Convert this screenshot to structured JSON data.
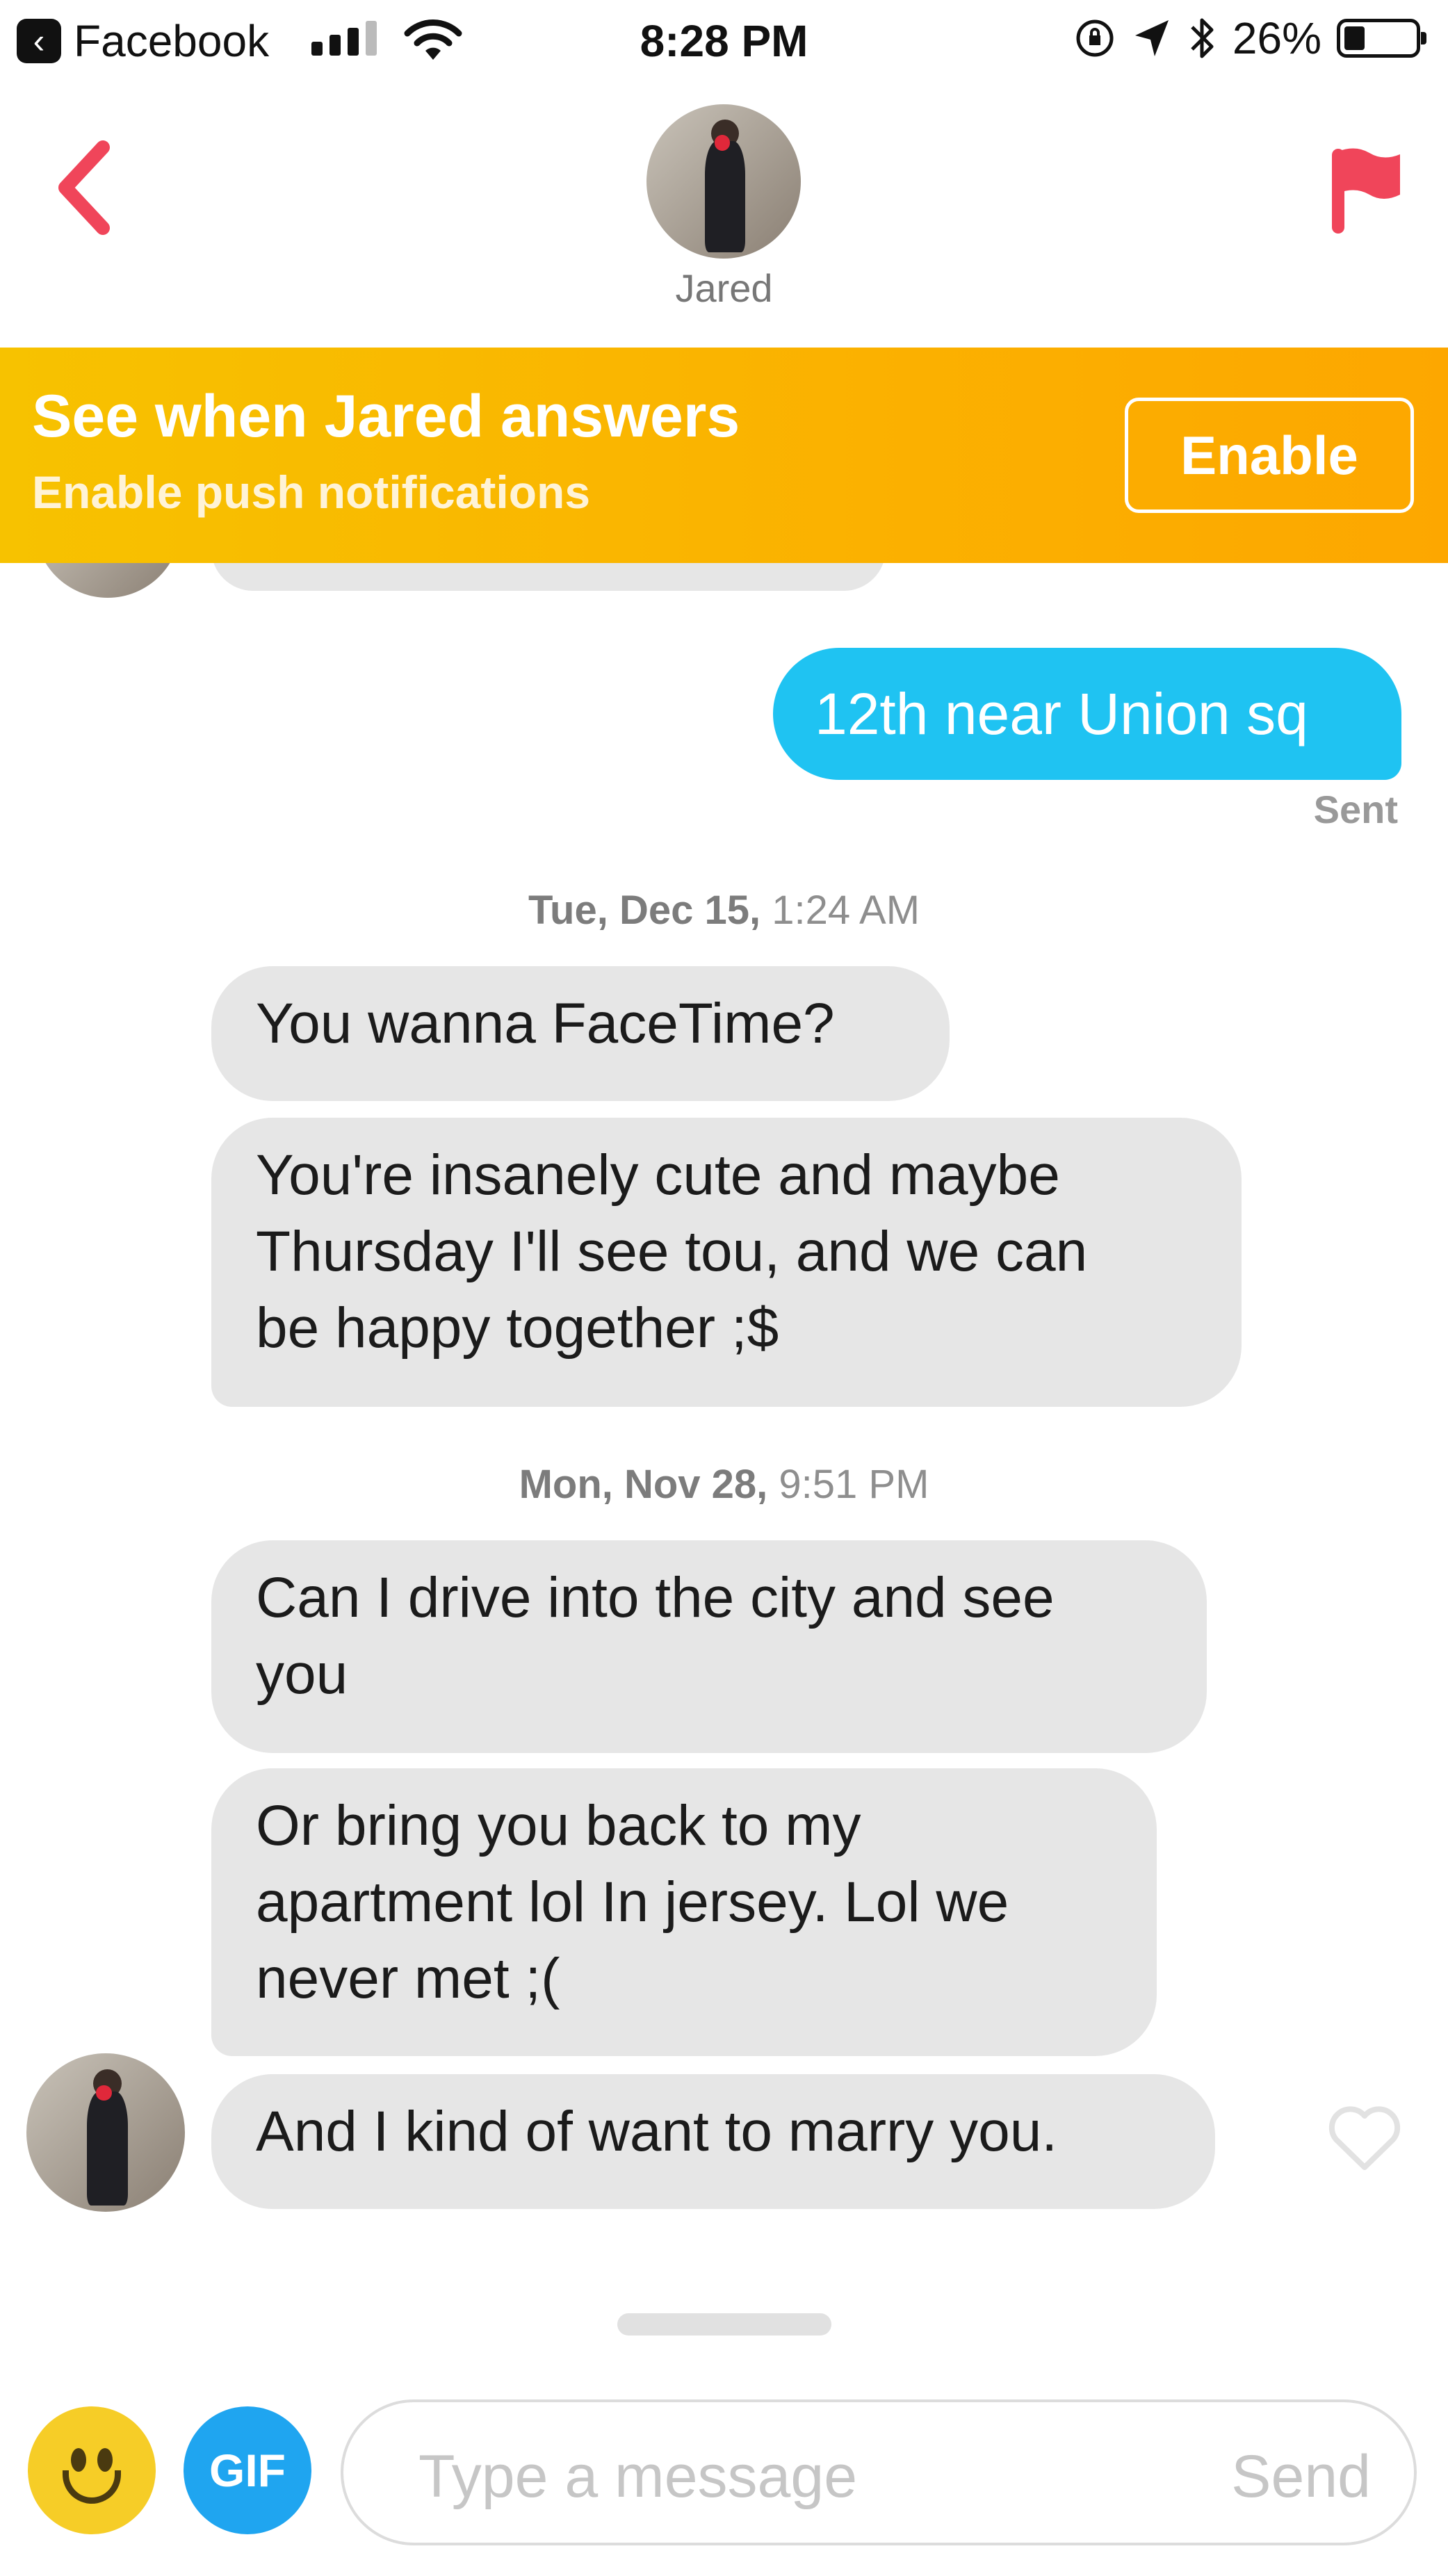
{
  "status_bar": {
    "back_app_label": "Facebook",
    "time": "8:28 PM",
    "battery_text": "26%",
    "battery_level": 0.26
  },
  "header": {
    "contact_name": "Jared"
  },
  "banner": {
    "title": "See when Jared answers",
    "subtitle": "Enable push notifications",
    "button_label": "Enable"
  },
  "messages": {
    "outgoing": [
      {
        "text": "12th near Union sq",
        "status": "Sent"
      }
    ],
    "groups": [
      {
        "timestamp_day": "Tue, Dec 15,",
        "timestamp_time": "1:24 AM",
        "incoming": [
          "You wanna FaceTime?",
          "You're insanely cute and maybe\nThursday I'll see tou, and we can\nbe happy together ;$"
        ]
      },
      {
        "timestamp_day": "Mon, Nov 28,",
        "timestamp_time": "9:51 PM",
        "incoming": [
          "Can I drive into the city and see\nyou",
          "Or bring you back to my\napartment lol In jersey. Lol we\nnever met ;(",
          "And I kind of want to marry you."
        ]
      }
    ]
  },
  "composer": {
    "gif_label": "GIF",
    "placeholder": "Type a message",
    "send_label": "Send"
  },
  "colors": {
    "accent_red": "#f0455a",
    "banner_yellow": "#f9b800",
    "outgoing_bubble": "#1fc3f2",
    "incoming_bubble": "#e6e6e6"
  }
}
